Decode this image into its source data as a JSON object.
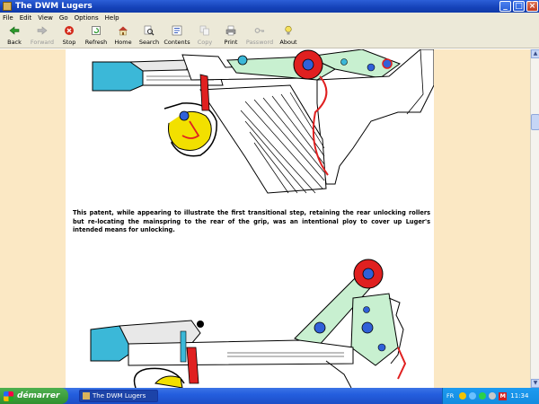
{
  "window": {
    "title": "The DWM Lugers"
  },
  "menu": [
    "File",
    "Edit",
    "View",
    "Go",
    "Options",
    "Help"
  ],
  "toolbar": {
    "back": "Back",
    "forward": "Forward",
    "stop": "Stop",
    "refresh": "Refresh",
    "home": "Home",
    "search": "Search",
    "contents": "Contents",
    "copy": "Copy",
    "print": "Print",
    "password": "Password",
    "about": "About"
  },
  "content": {
    "caption": "This patent, while appearing to illustrate the first transitional step, retaining the rear unlocking rollers but re-locating the mainspring to the rear of the grip, was an intentional ploy to cover up Luger's intended means for unlocking."
  },
  "taskbar": {
    "start": "démarrer",
    "task": "The DWM Lugers",
    "lang": "FR",
    "clock": "11:34",
    "tray_m": "M"
  },
  "colors": {
    "titlebar": "#1542b8",
    "page_bg": "#fbe8c4",
    "barrel_cyan": "#3bb8d8",
    "roller_red": "#e02020",
    "lever_green": "#c8f0d0",
    "yellow": "#f2e000"
  }
}
